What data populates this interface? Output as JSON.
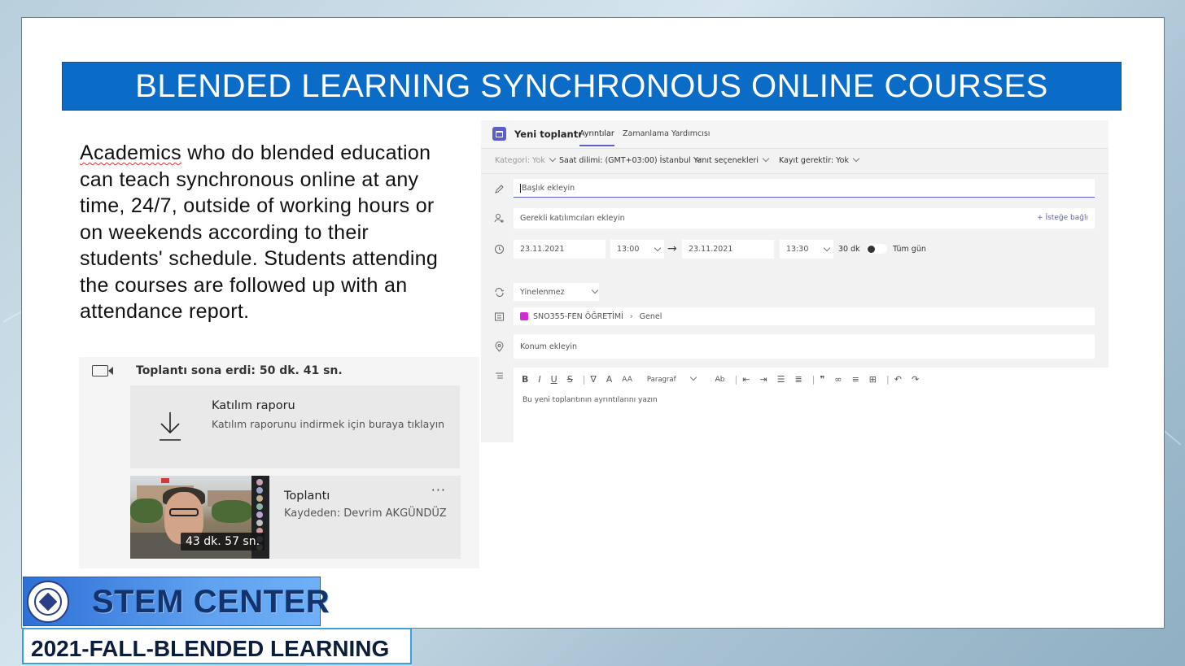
{
  "slide": {
    "title": "BLENDED LEARNING SYNCHRONOUS ONLINE COURSES",
    "body_first_word": "Academics",
    "body_rest": " who do blended education can teach synchronous online at any time, 24/7, outside of working hours or on weekends according to their students' schedule. Students attending the courses are followed up with an attendance report."
  },
  "attendance": {
    "ended_text": "Toplantı sona erdi: 50 dk. 41 sn.",
    "report_title": "Katılım raporu",
    "report_subtitle": "Katılım raporunu indirmek için buraya tıklayın",
    "recording_title": "Toplantı",
    "recording_subtitle": "Kaydeden: Devrim AKGÜNDÜZ",
    "recording_duration": "43 dk. 57 sn.",
    "more_label": "···"
  },
  "teams": {
    "header_title": "Yeni toplantı",
    "tabs": [
      "Ayrıntılar",
      "Zamanlama Yardımcısı"
    ],
    "options": {
      "category": "Kategori: Yok",
      "timezone": "Saat dilimi: (GMT+03:00) İstanbul",
      "response": "Yanıt seçenekleri",
      "recording": "Kayıt gerektir: Yok"
    },
    "title_placeholder": "Başlık ekleyin",
    "attendees_placeholder": "Gerekli katılımcıları ekleyin",
    "optional_label": "+ İsteğe bağlı",
    "start_date": "23.11.2021",
    "start_time": "13:00",
    "end_date": "23.11.2021",
    "end_time": "13:30",
    "duration": "30 dk",
    "all_day": "Tüm gün",
    "repeat": "Yinelenmez",
    "channel_team": "SNO355-FEN ÖĞRETİMİ",
    "channel_name": "Genel",
    "location_placeholder": "Konum ekleyin",
    "editor_paragraph": "Paragraf",
    "editor_placeholder": "Bu yeni toplantının ayrıntılarını yazın"
  },
  "footer": {
    "stem_label": "STEM CENTER",
    "semester_label": "2021-FALL-BLENDED LEARNING"
  },
  "colors": {
    "title_bar": "#0b6cc7",
    "teams_accent": "#5b5fc7",
    "stem_text": "#12336e"
  }
}
